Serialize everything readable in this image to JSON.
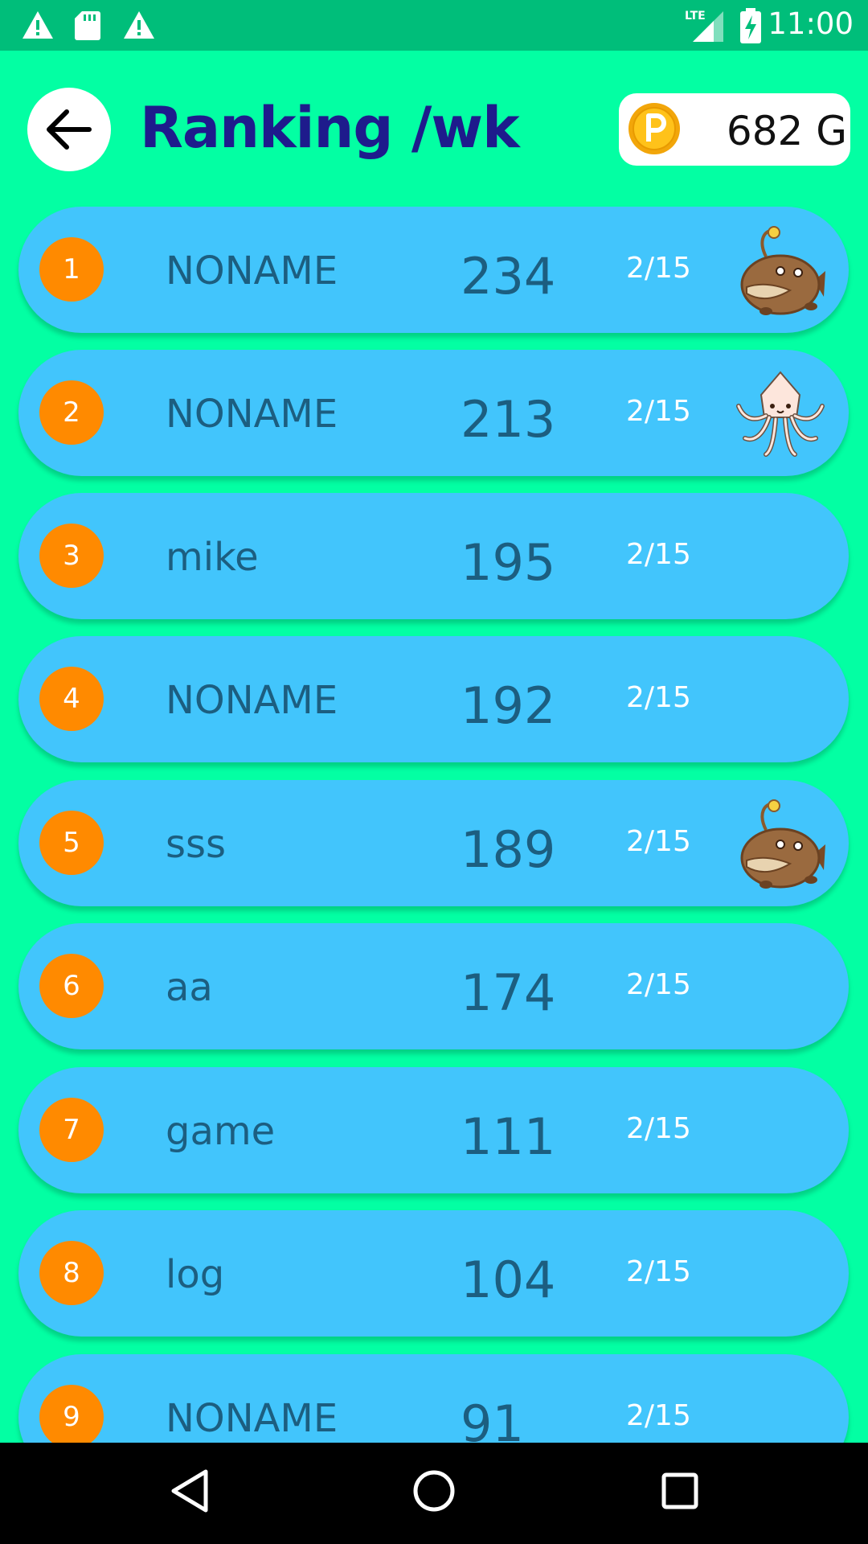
{
  "status_bar": {
    "time": "11:00",
    "icons": [
      "warning-icon",
      "sd-card-icon",
      "warning-icon",
      "lte-signal-icon",
      "battery-charging-icon"
    ]
  },
  "header": {
    "title": "Ranking /wk",
    "back_icon": "arrow-left-icon",
    "coins": {
      "icon": "p-coin-icon",
      "value": "682 G"
    }
  },
  "rankings": [
    {
      "rank": "1",
      "name": "NONAME",
      "score": "234",
      "date": "2/15",
      "mascot": "anglerfish"
    },
    {
      "rank": "2",
      "name": "NONAME",
      "score": "213",
      "date": "2/15",
      "mascot": "squid"
    },
    {
      "rank": "3",
      "name": "mike",
      "score": "195",
      "date": "2/15",
      "mascot": ""
    },
    {
      "rank": "4",
      "name": "NONAME",
      "score": "192",
      "date": "2/15",
      "mascot": ""
    },
    {
      "rank": "5",
      "name": "sss",
      "score": "189",
      "date": "2/15",
      "mascot": "anglerfish"
    },
    {
      "rank": "6",
      "name": "aa",
      "score": "174",
      "date": "2/15",
      "mascot": ""
    },
    {
      "rank": "7",
      "name": "game",
      "score": "111",
      "date": "2/15",
      "mascot": ""
    },
    {
      "rank": "8",
      "name": "log",
      "score": "104",
      "date": "2/15",
      "mascot": ""
    },
    {
      "rank": "9",
      "name": "NONAME",
      "score": "91",
      "date": "2/15",
      "mascot": ""
    }
  ],
  "nav_bar": {
    "icons": [
      "back-triangle-icon",
      "home-circle-icon",
      "recents-square-icon"
    ]
  },
  "colors": {
    "background": "#03FFA3",
    "status_bar": "#00BE7A",
    "row": "#42C5FC",
    "badge": "#FF8A00",
    "title": "#1E1B8C",
    "row_text": "#1C5E80"
  }
}
